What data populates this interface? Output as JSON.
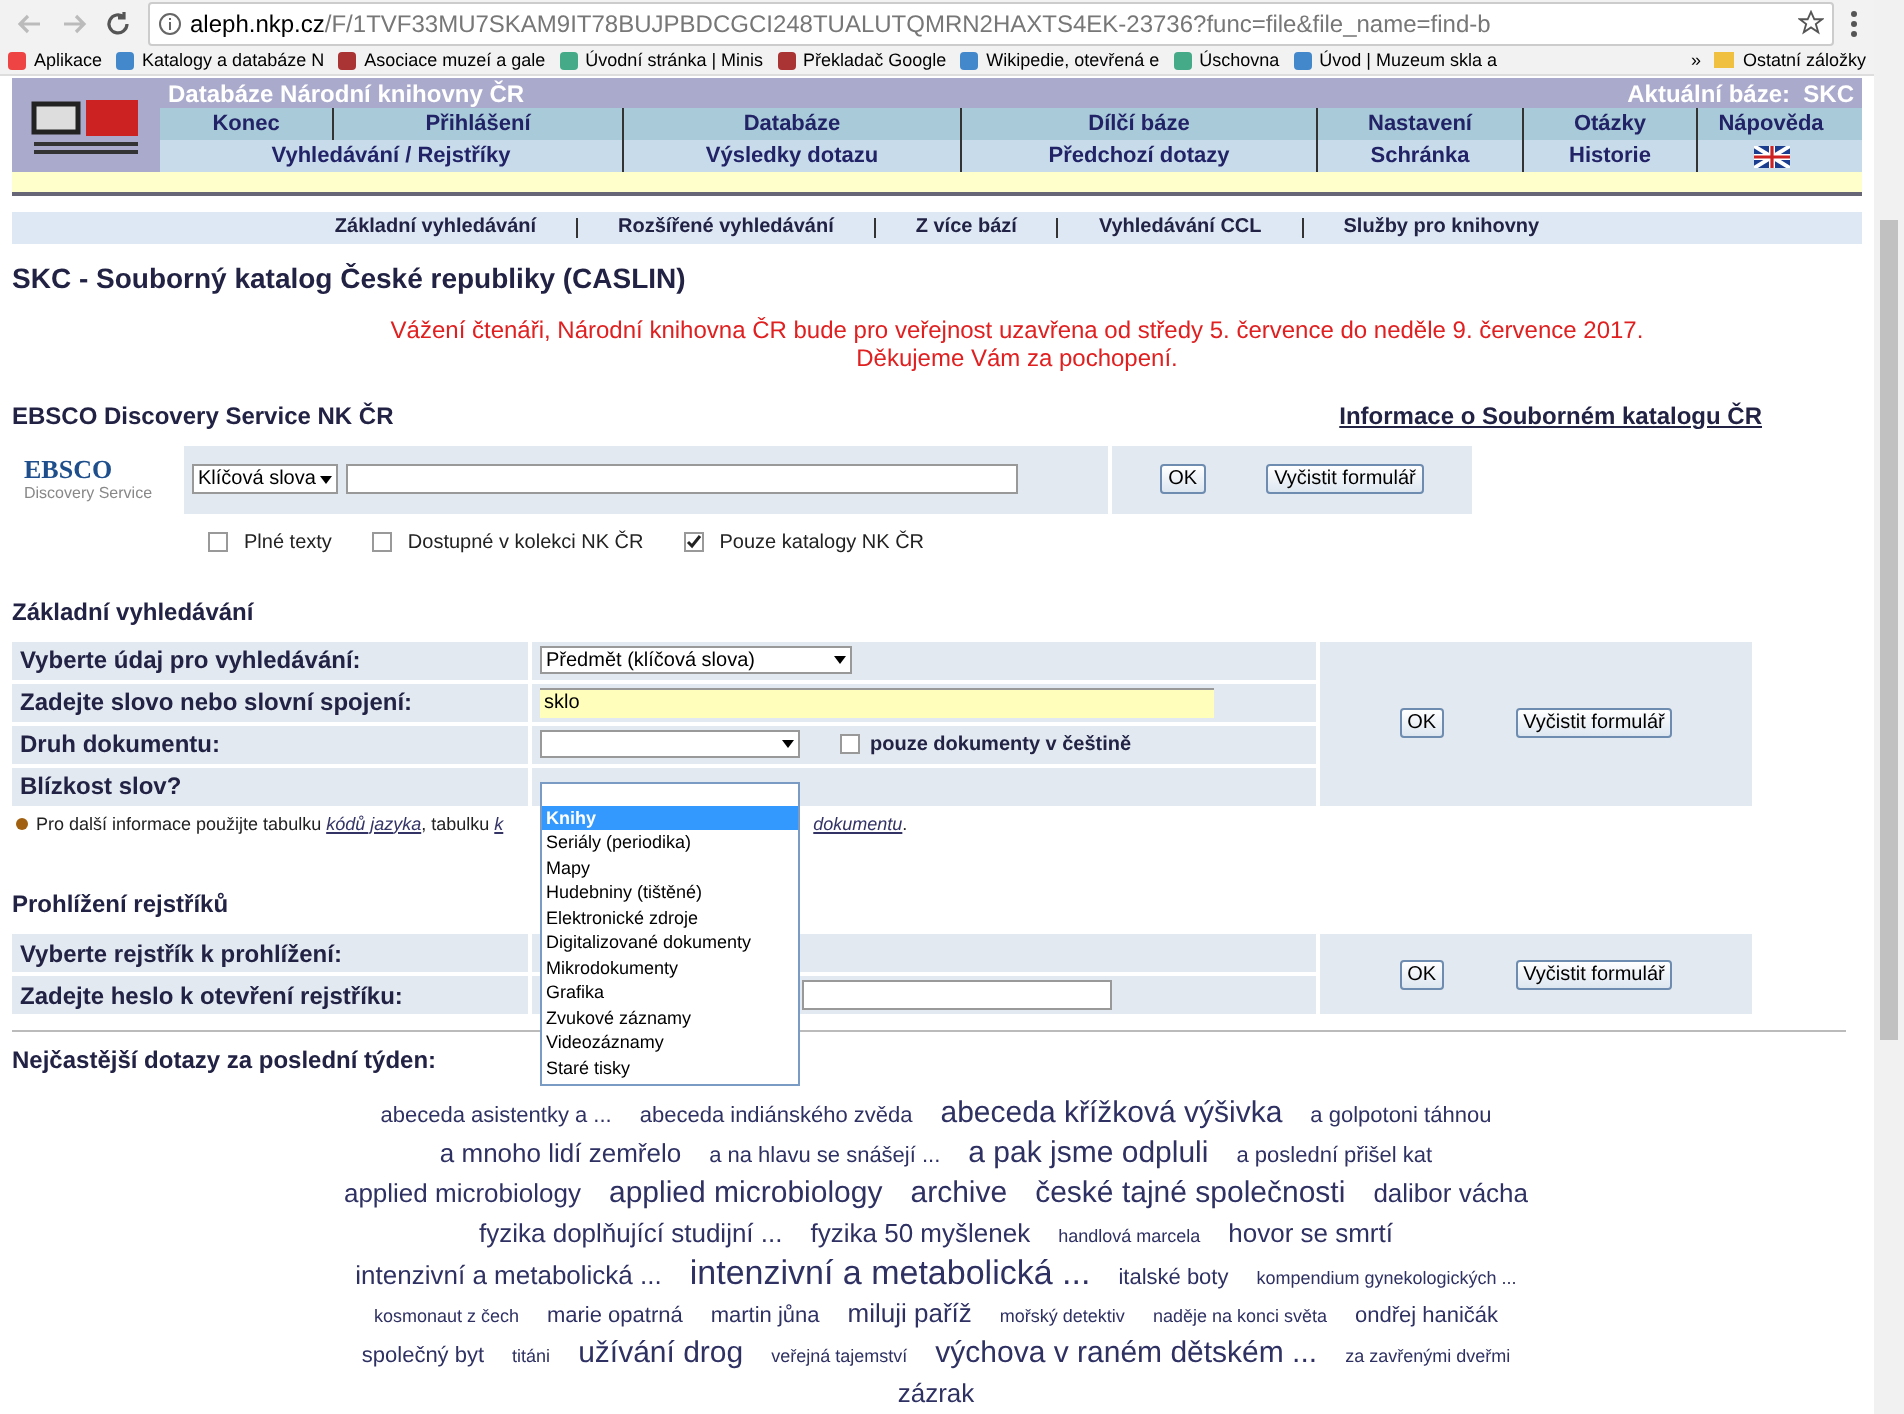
{
  "browser": {
    "url_host": "aleph.nkp.cz",
    "url_path": "/F/1TVF33MU7SKAM9IT78BUJPBDCGCI248TUALUTQMRN2HAXTS4EK-23736?func=file&file_name=find-b",
    "bookmarks": [
      "Aplikace",
      "Katalogy a databáze N",
      "Asociace muzeí a gale",
      "Úvodní stránka | Minis",
      "Překladač Google",
      "Wikipedie, otevřená e",
      "Úschovna",
      "Úvod | Muzeum skla a"
    ],
    "overflow": "»",
    "other_bookmarks": "Ostatní záložky"
  },
  "header": {
    "title": "Databáze Národní knihovny ČR",
    "current_base": "Aktuální báze:  SKC",
    "nav_row_1": [
      "Konec",
      "Přihlášení",
      "Databáze",
      "Dílčí báze",
      "Nastavení",
      "Otázky",
      "Nápověda"
    ],
    "nav_row_2": [
      "Vyhledávání / Rejstříky",
      "Výsledky dotazu",
      "Předchozí dotazy",
      "Schránka",
      "Historie"
    ]
  },
  "sub_nav": [
    "Základní vyhledávání",
    "Rozšířené vyhledávání",
    "Z více bází",
    "Vyhledávání CCL",
    "Služby pro knihovny"
  ],
  "page_title": "SKC - Souborný katalog České republiky (CASLIN)",
  "notice": [
    "Vážení čtenáři, Národní knihovna ČR bude pro veřejnost uzavřena od středy 5. července do neděle 9. července 2017.",
    "Děkujeme Vám za pochopení."
  ],
  "ebsco": {
    "heading": "EBSCO Discovery Service NK ČR",
    "info_link": "Informace o Souborném katalogu ČR",
    "logo_text": "EBSCO",
    "logo_sub": "Discovery Service",
    "select": "Klíčová slova",
    "buttons": [
      "OK",
      "Vyčistit formulář"
    ],
    "options": [
      {
        "label": "Plné texty",
        "checked": false
      },
      {
        "label": "Dostupné v kolekci NK ČR",
        "checked": false
      },
      {
        "label": "Pouze katalogy NK ČR",
        "checked": true
      }
    ]
  },
  "basic_search": {
    "heading": "Základní vyhledávání",
    "rows": [
      {
        "label": "Vyberte údaj pro vyhledávání:",
        "kind": "select",
        "value": "Předmět (klíčová slova)"
      },
      {
        "label": "Zadejte slovo nebo slovní spojení:",
        "kind": "text",
        "value": "sklo"
      },
      {
        "label": "Druh dokumentu:",
        "kind": "select",
        "value": "",
        "checkbox": {
          "label": "pouze dokumenty v češtině",
          "checked": false
        }
      },
      {
        "label": "Blízkost slov?",
        "kind": "none"
      }
    ],
    "buttons": [
      "OK",
      "Vyčistit formulář"
    ],
    "info": {
      "before": "Pro další informace použijte tabulku ",
      "link_1": "kódů jazyka",
      "middle": ", tabulku ",
      "link_2": "k",
      "link_3": "dokumentu",
      "after": "."
    },
    "dropdown": [
      {
        "label": "Knihy",
        "selected": true
      },
      {
        "label": "Seriály (periodika)",
        "selected": false
      },
      {
        "label": "Mapy",
        "selected": false
      },
      {
        "label": "Hudebniny (tištěné)",
        "selected": false
      },
      {
        "label": "Elektronické zdroje",
        "selected": false
      },
      {
        "label": "Digitalizované dokumenty",
        "selected": false
      },
      {
        "label": "Mikrodokumenty",
        "selected": false
      },
      {
        "label": "Grafika",
        "selected": false
      },
      {
        "label": "Zvukové záznamy",
        "selected": false
      },
      {
        "label": "Videozáznamy",
        "selected": false
      },
      {
        "label": "Staré tisky",
        "selected": false
      }
    ]
  },
  "browse": {
    "heading": "Prohlížení rejstříků",
    "rows": [
      "Vyberte rejstřík k prohlížení:",
      "Zadejte heslo k otevření rejstříku:"
    ],
    "buttons": [
      "OK",
      "Vyčistit formulář"
    ]
  },
  "popular": {
    "heading": "Nejčastější dotazy za poslední týden:",
    "lines": [
      [
        {
          "text": "abeceda asistentky a ...",
          "kind": "s"
        },
        {
          "text": "abeceda indiánského zvěda",
          "kind": "s"
        },
        {
          "text": "abeceda křížková výšivka",
          "kind": "l"
        },
        {
          "text": "a golpotoni táhnou",
          "kind": "s"
        }
      ],
      [
        {
          "text": "a mnoho lidí zemřelo",
          "kind": "m"
        },
        {
          "text": "a na hlavu se snášejí ...",
          "kind": "s"
        },
        {
          "text": "a pak jsme odpluli",
          "kind": "l"
        },
        {
          "text": "a poslední přišel kat",
          "kind": "s"
        }
      ],
      [
        {
          "text": "applied microbiology",
          "kind": "m"
        },
        {
          "text": "applied microbiology",
          "kind": "l"
        },
        {
          "text": "archive",
          "kind": "l"
        },
        {
          "text": "české tajné společnosti",
          "kind": "l"
        },
        {
          "text": "dalibor vácha",
          "kind": "m"
        }
      ],
      [
        {
          "text": "fyzika doplňující studijní ...",
          "kind": "m"
        },
        {
          "text": "fyzika 50 myšlenek",
          "kind": "m"
        },
        {
          "text": "handlová marcela",
          "kind": "xs"
        },
        {
          "text": "hovor se smrtí",
          "kind": "m"
        }
      ],
      [
        {
          "text": "intenzivní a metabolická ...",
          "kind": "m"
        },
        {
          "text": "intenzivní a metabolická ...",
          "kind": "xl"
        },
        {
          "text": "italské boty",
          "kind": "s"
        },
        {
          "text": "kompendium gynekologických ...",
          "kind": "xs"
        }
      ],
      [
        {
          "text": "kosmonaut z čech",
          "kind": "xs"
        },
        {
          "text": "marie opatrná",
          "kind": "s"
        },
        {
          "text": "martin jůna",
          "kind": "s"
        },
        {
          "text": "miluji paříž",
          "kind": "m"
        },
        {
          "text": "mořský detektiv",
          "kind": "xs"
        },
        {
          "text": "naděje na konci světa",
          "kind": "xs"
        },
        {
          "text": "ondřej haničák",
          "kind": "s"
        }
      ],
      [
        {
          "text": "společný byt",
          "kind": "s"
        },
        {
          "text": "titáni",
          "kind": "xs"
        },
        {
          "text": "užívání drog",
          "kind": "l"
        },
        {
          "text": "veřejná tajemství",
          "kind": "xs"
        },
        {
          "text": "výchova v raném dětském ...",
          "kind": "l"
        },
        {
          "text": "za zavřenými dveřmi",
          "kind": "xs"
        }
      ],
      [
        {
          "text": "zázrak",
          "kind": "m"
        }
      ]
    ]
  }
}
